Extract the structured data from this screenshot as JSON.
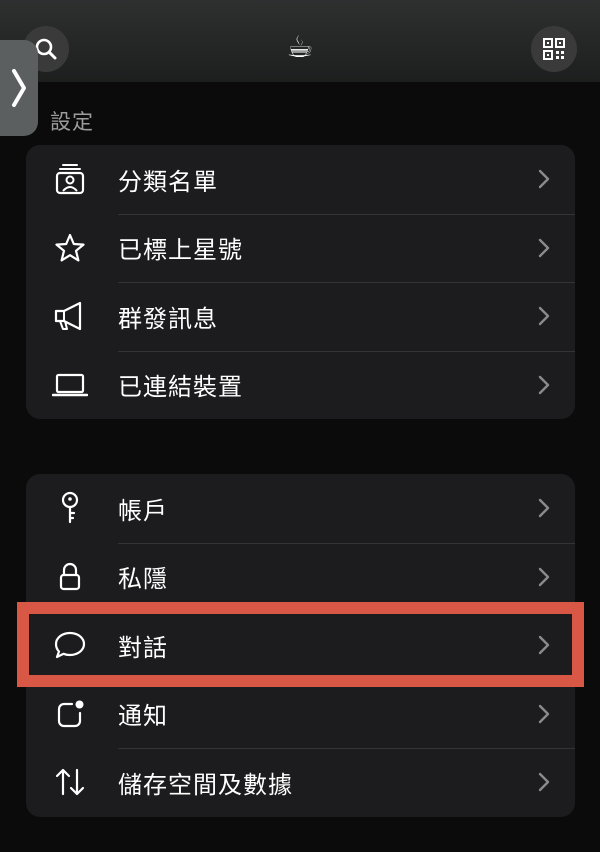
{
  "header": {
    "center_icon": "coffee-icon",
    "center_glyph": "☕",
    "left_icon": "search-icon",
    "right_icon": "qr-code-icon"
  },
  "side_tab": {
    "icon": "chevron-right-icon"
  },
  "section_title": "設定",
  "group1": [
    {
      "label": "分類名單",
      "icon": "contact-list-icon"
    },
    {
      "label": "已標上星號",
      "icon": "star-icon"
    },
    {
      "label": "群發訊息",
      "icon": "megaphone-icon"
    },
    {
      "label": "已連結裝置",
      "icon": "laptop-icon"
    }
  ],
  "group2": [
    {
      "label": "帳戶",
      "icon": "key-icon"
    },
    {
      "label": "私隱",
      "icon": "lock-icon"
    },
    {
      "label": "對話",
      "icon": "chat-bubble-icon"
    },
    {
      "label": "通知",
      "icon": "notification-icon"
    },
    {
      "label": "儲存空間及數據",
      "icon": "data-arrows-icon"
    }
  ],
  "colors": {
    "background": "#0b0b0b",
    "card": "#1c1c1e",
    "highlight": "#d95745",
    "secondary_text": "#9c9c9c"
  }
}
